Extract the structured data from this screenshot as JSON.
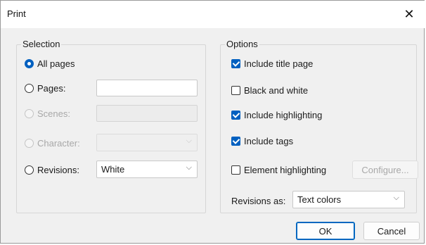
{
  "window": {
    "title": "Print",
    "close_glyph": "✕"
  },
  "selection": {
    "legend": "Selection",
    "all_pages": "All pages",
    "pages": "Pages:",
    "pages_value": "",
    "scenes": "Scenes:",
    "scenes_value": "",
    "character": "Character:",
    "character_value": "",
    "revisions": "Revisions:",
    "revisions_value": "White"
  },
  "options": {
    "legend": "Options",
    "include_title_page": "Include title page",
    "black_and_white": "Black and white",
    "include_highlighting": "Include highlighting",
    "include_tags": "Include tags",
    "element_highlighting": "Element highlighting",
    "configure": "Configure...",
    "revisions_as_label": "Revisions as:",
    "revisions_as_value": "Text colors"
  },
  "buttons": {
    "ok": "OK",
    "cancel": "Cancel"
  },
  "state": {
    "selected_range": "All pages",
    "include_title_page": true,
    "black_and_white": false,
    "include_highlighting": true,
    "include_tags": true,
    "element_highlighting": false
  },
  "colors": {
    "accent": "#0060c0",
    "background": "#f0f0f0",
    "disabled_text": "#a8a8a8"
  },
  "icons": {
    "dropdown": "chevron-down-icon",
    "close": "close-icon"
  }
}
